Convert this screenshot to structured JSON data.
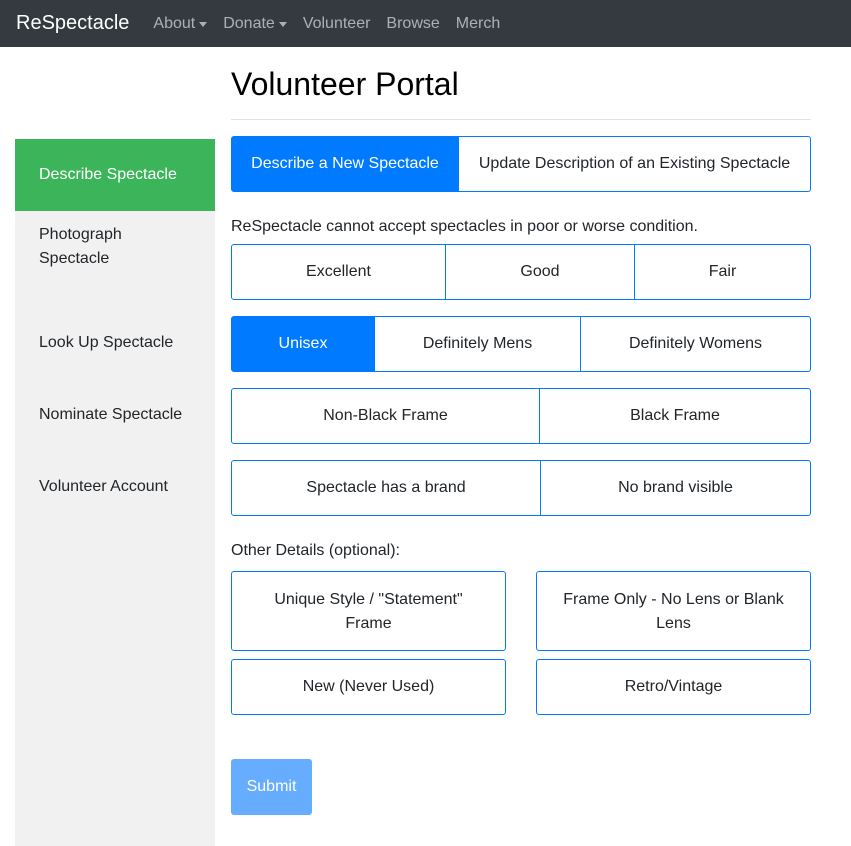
{
  "navbar": {
    "brand": "ReSpectacle",
    "items": [
      "About",
      "Donate",
      "Volunteer",
      "Browse",
      "Merch"
    ]
  },
  "sidebar": {
    "items": [
      {
        "label": "Describe Spectacle"
      },
      {
        "label": "Photograph Spectacle"
      },
      {
        "label": "Look Up Spectacle"
      },
      {
        "label": "Nominate Spectacle"
      },
      {
        "label": "Volunteer Account"
      }
    ]
  },
  "page": {
    "title": "Volunteer Portal"
  },
  "mode": {
    "new": "Describe a New Spectacle",
    "update": "Update Description of an Existing Spectacle"
  },
  "condition": {
    "note": "ReSpectacle cannot accept spectacles in poor or worse condition.",
    "options": [
      "Excellent",
      "Good",
      "Fair"
    ]
  },
  "gender": {
    "options": [
      "Unisex",
      "Definitely Mens",
      "Definitely Womens"
    ]
  },
  "frame": {
    "options": [
      "Non-Black Frame",
      "Black Frame"
    ]
  },
  "brand": {
    "options": [
      "Spectacle has a brand",
      "No brand visible"
    ]
  },
  "other": {
    "label": "Other Details (optional):",
    "options": [
      "Unique Style / \"Statement\" Frame",
      "Frame Only - No Lens or Blank Lens",
      "New (Never Used)",
      "Retro/Vintage"
    ]
  },
  "form": {
    "submit_label": "Submit"
  },
  "colors": {
    "primary": "#007bff",
    "sidebar_active": "#3cb55a",
    "navbar": "#343a40",
    "submit_disabled": "#66adff"
  }
}
